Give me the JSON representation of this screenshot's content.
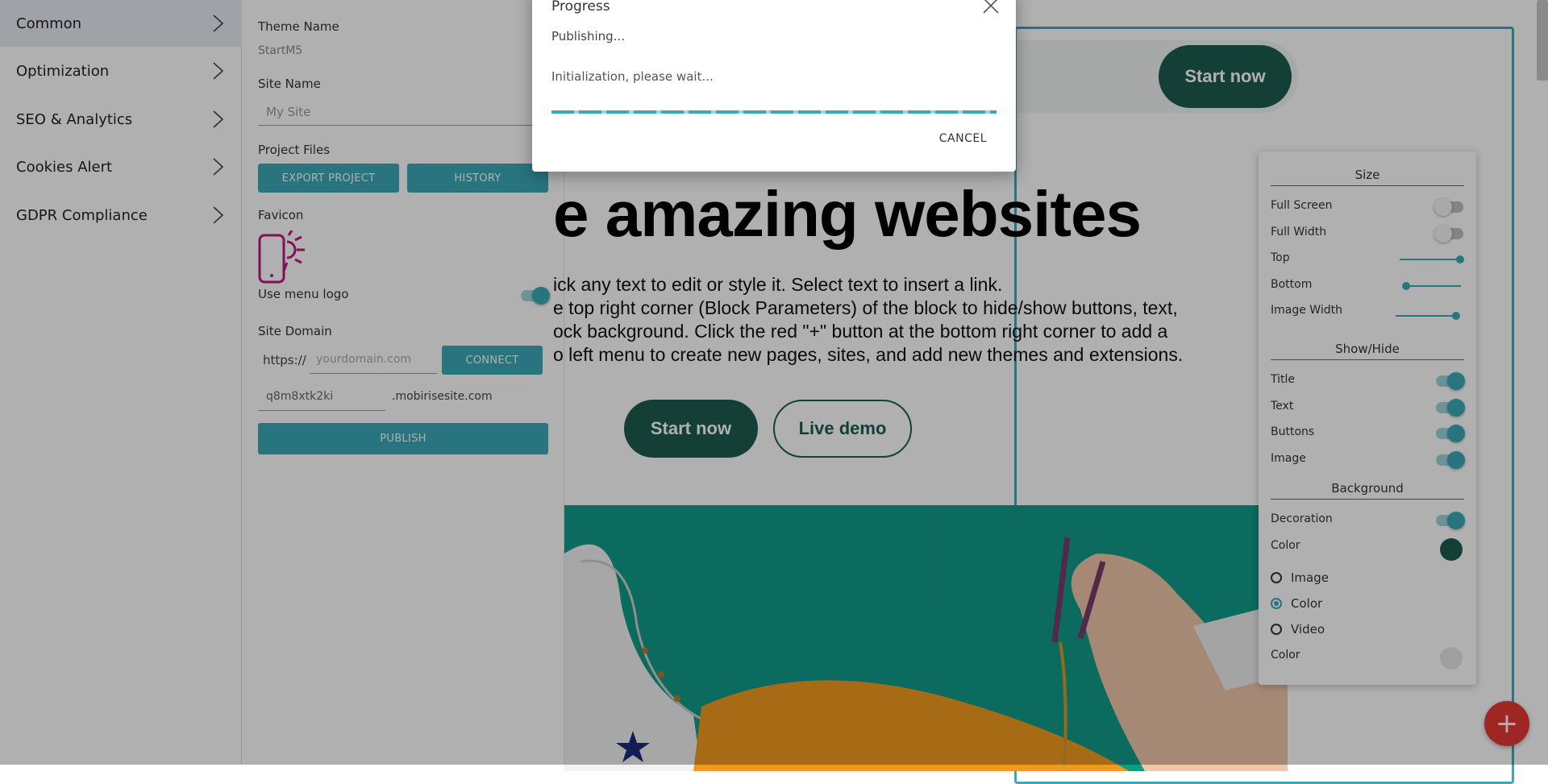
{
  "nav": {
    "items": [
      {
        "label": "Common",
        "active": true
      },
      {
        "label": "Optimization"
      },
      {
        "label": "SEO & Analytics"
      },
      {
        "label": "Cookies Alert"
      },
      {
        "label": "GDPR Compliance"
      }
    ]
  },
  "settings": {
    "theme_name_label": "Theme Name",
    "theme_name_value": "StartM5",
    "site_name_label": "Site Name",
    "site_name_placeholder": "My Site",
    "project_files_label": "Project Files",
    "export_button": "EXPORT PROJECT",
    "history_button": "HISTORY",
    "favicon_label": "Favicon",
    "use_menu_logo_label": "Use menu logo",
    "use_menu_logo_on": true,
    "site_domain_label": "Site Domain",
    "https_prefix": "https://",
    "domain_placeholder": "yourdomain.com",
    "connect_button": "CONNECT",
    "subdomain_value": "q8m8xtk2ki",
    "subdomain_suffix": ".mobirisesite.com",
    "publish_button": "PUBLISH"
  },
  "preview": {
    "header_button": "Start now",
    "hero_title": "e amazing websites",
    "hero_lines": [
      "ick any text to edit or style it. Select text to insert a link.",
      "e top right corner (Block Parameters) of the block to hide/show buttons, text,",
      "ock background. Click the red \"+\" button at the bottom right corner to add a",
      "o left menu to create new pages, sites, and add new themes and extensions."
    ],
    "primary_button": "Start now",
    "secondary_button": "Live demo",
    "fab_label": "+"
  },
  "params": {
    "size_title": "Size",
    "full_screen": "Full Screen",
    "full_screen_on": false,
    "full_width": "Full Width",
    "full_width_on": false,
    "top": "Top",
    "top_value": 1.0,
    "bottom": "Bottom",
    "bottom_value": 0.0,
    "image_width": "Image Width",
    "image_width_value": 1.0,
    "showhide_title": "Show/Hide",
    "title": "Title",
    "text": "Text",
    "buttons": "Buttons",
    "image": "Image",
    "background_title": "Background",
    "decoration": "Decoration",
    "color": "Color",
    "color_value": "#1e5c50",
    "radio_image": "Image",
    "radio_color": "Color",
    "radio_video": "Video",
    "color2": "Color",
    "color2_value": "#e6e6e6",
    "selected_background": "Color"
  },
  "dialog": {
    "title": "Progress",
    "message": "Publishing...",
    "status": "Initialization, please wait...",
    "cancel": "CANCEL"
  },
  "colors": {
    "accent": "#3aaab8",
    "brand_dark": "#1e5c50",
    "hero_bg": "#0f9c88",
    "fab": "#e53935"
  }
}
